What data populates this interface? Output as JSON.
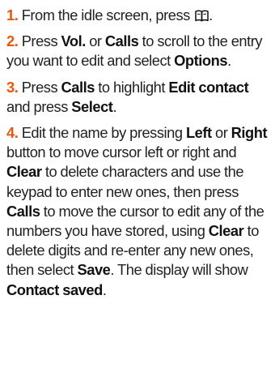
{
  "steps": [
    {
      "number": "1.",
      "parts": [
        {
          "t": "text",
          "v": " From the idle screen, press "
        },
        {
          "t": "icon",
          "name": "phonebook-icon"
        },
        {
          "t": "text",
          "v": "."
        }
      ]
    },
    {
      "number": "2.",
      "parts": [
        {
          "t": "text",
          "v": " Press "
        },
        {
          "t": "kw",
          "v": "Vol."
        },
        {
          "t": "text",
          "v": " or "
        },
        {
          "t": "kw",
          "v": "Calls"
        },
        {
          "t": "text",
          "v": " to scroll to the entry you want to edit and select "
        },
        {
          "t": "kw",
          "v": "Options"
        },
        {
          "t": "text",
          "v": "."
        }
      ]
    },
    {
      "number": "3.",
      "parts": [
        {
          "t": "text",
          "v": " Press "
        },
        {
          "t": "kw",
          "v": "Calls"
        },
        {
          "t": "text",
          "v": " to highlight "
        },
        {
          "t": "kw",
          "v": "Edit contact"
        },
        {
          "t": "text",
          "v": " and press "
        },
        {
          "t": "kw",
          "v": "Select"
        },
        {
          "t": "text",
          "v": "."
        }
      ]
    },
    {
      "number": "4.",
      "parts": [
        {
          "t": "text",
          "v": " Edit the name by pressing "
        },
        {
          "t": "kw",
          "v": "Left"
        },
        {
          "t": "text",
          "v": " or "
        },
        {
          "t": "kw",
          "v": "Right"
        },
        {
          "t": "text",
          "v": " button to move cursor left or right and "
        },
        {
          "t": "kw",
          "v": "Clear"
        },
        {
          "t": "text",
          "v": " to delete characters and use the keypad to enter new ones, then press "
        },
        {
          "t": "kw",
          "v": "Calls"
        },
        {
          "t": "text",
          "v": " to move the cursor to edit any of the numbers you have stored, using "
        },
        {
          "t": "kw",
          "v": "Clear"
        },
        {
          "t": "text",
          "v": " to delete digits and re-enter any new ones, then select "
        },
        {
          "t": "kw",
          "v": "Save"
        },
        {
          "t": "text",
          "v": ". The display will show "
        },
        {
          "t": "kw",
          "v": "Contact saved"
        },
        {
          "t": "text",
          "v": "."
        }
      ]
    }
  ],
  "colors": {
    "step_number": "#e8570d",
    "body_text": "#222222",
    "keyword": "#111111"
  }
}
